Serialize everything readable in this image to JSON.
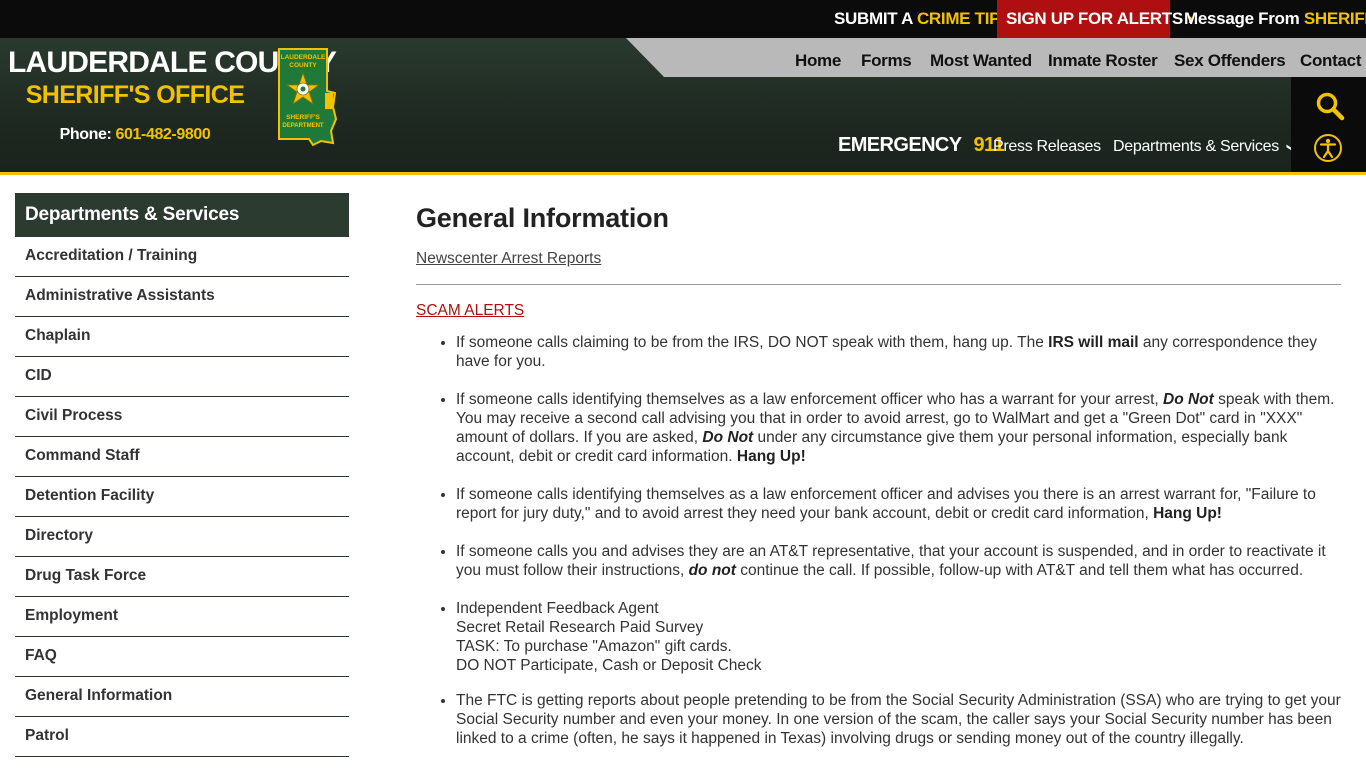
{
  "topbar": {
    "crime_tip_pre": "SUBMIT A",
    "crime_tip_hl": "CRIME TIP",
    "alerts": "SIGN UP FOR ALERTS",
    "message_pre": "Message From",
    "message_hl": "SHERIFF",
    "chevron": "›"
  },
  "logo": {
    "title": "LAUDERDALE COUNTY",
    "subtitle": "SHERIFF'S OFFICE",
    "phone_label": "Phone:",
    "phone": "601-482-9800",
    "seal_top": "LAUDERDALE",
    "seal_mid": "COUNTY",
    "seal_bottom1": "SHERIFF'S",
    "seal_bottom2": "DEPARTMENT"
  },
  "nav": {
    "home": "Home",
    "forms": "Forms",
    "most_wanted": "Most Wanted",
    "inmate_roster": "Inmate Roster",
    "sex_offenders": "Sex Offenders",
    "contact": "Contact",
    "emergency_label": "EMERGENCY",
    "emergency_number": "911",
    "press_releases": "Press Releases",
    "departments": "Departments & Services",
    "caret": "❯"
  },
  "sidebar": {
    "heading": "Departments & Services",
    "items": [
      "Accreditation / Training",
      "Administrative Assistants",
      "Chaplain",
      "CID",
      "Civil Process",
      "Command Staff",
      "Detention Facility",
      "Directory",
      "Drug Task Force",
      "Employment",
      "FAQ",
      "General Information",
      "Patrol"
    ]
  },
  "main": {
    "title": "General Information",
    "arrest_link": "Newscenter Arrest Reports",
    "scam_link": "SCAM ALERTS",
    "b1": {
      "t1": "If someone calls claiming to be from the IRS, DO NOT speak with them, hang up. The ",
      "s1": "IRS will mail",
      "t2": " any correspondence they have for you."
    },
    "b2": {
      "t1": "If someone calls identifying themselves as a law enforcement officer who has a warrant for your arrest, ",
      "s1": "Do Not",
      "t2": " speak with them. You may receive a second call advising you that in order to avoid arrest, go to WalMart and get a \"Green Dot\" card in \"XXX\" amount of dollars. If you are asked, ",
      "s2": "Do Not",
      "t3": " under any circumstance give them your personal information, especially bank account, debit or credit card information. ",
      "s3": "Hang Up!"
    },
    "b3": {
      "t1": "If someone calls identifying themselves as a law enforcement officer and advises you there is an arrest warrant for, \"Failure to report for jury duty,\" and to avoid arrest they need your bank account, debit or credit card information, ",
      "s1": "Hang Up!"
    },
    "b4": {
      "t1": "If someone calls you and advises they are an AT&T representative, that your account is suspended, and in order to reactivate it you must follow their instructions, ",
      "s1": "do not",
      "t2": " continue the call. If possible, follow-up with AT&T and tell them what has occurred."
    },
    "b5": {
      "l1": "Independent Feedback Agent",
      "l2": "Secret Retail Research Paid Survey",
      "l3": "TASK: To purchase \"Amazon\" gift cards.",
      "l4": "DO NOT Participate, Cash or Deposit Check"
    },
    "b6": {
      "t1": "The FTC is getting reports about people pretending to be from the Social Security Administration (SSA) who are trying to get your Social Security number and even your money. In one version of the scam, the caller says your Social Security number has been linked to a crime (often, he says it happened in Texas) involving drugs or sending money out of the country illegally."
    }
  },
  "colors": {
    "brand_green": "#2b3b2f",
    "accent_gold": "#f2c200",
    "alert_red": "#b00f12",
    "top_black": "#0b0b0b",
    "nav_gray": "#b9b9b9"
  },
  "icons": {
    "search": "search-icon",
    "accessibility": "accessibility-icon",
    "chevron": "chevron-right-icon",
    "caret": "chevron-down-icon"
  }
}
